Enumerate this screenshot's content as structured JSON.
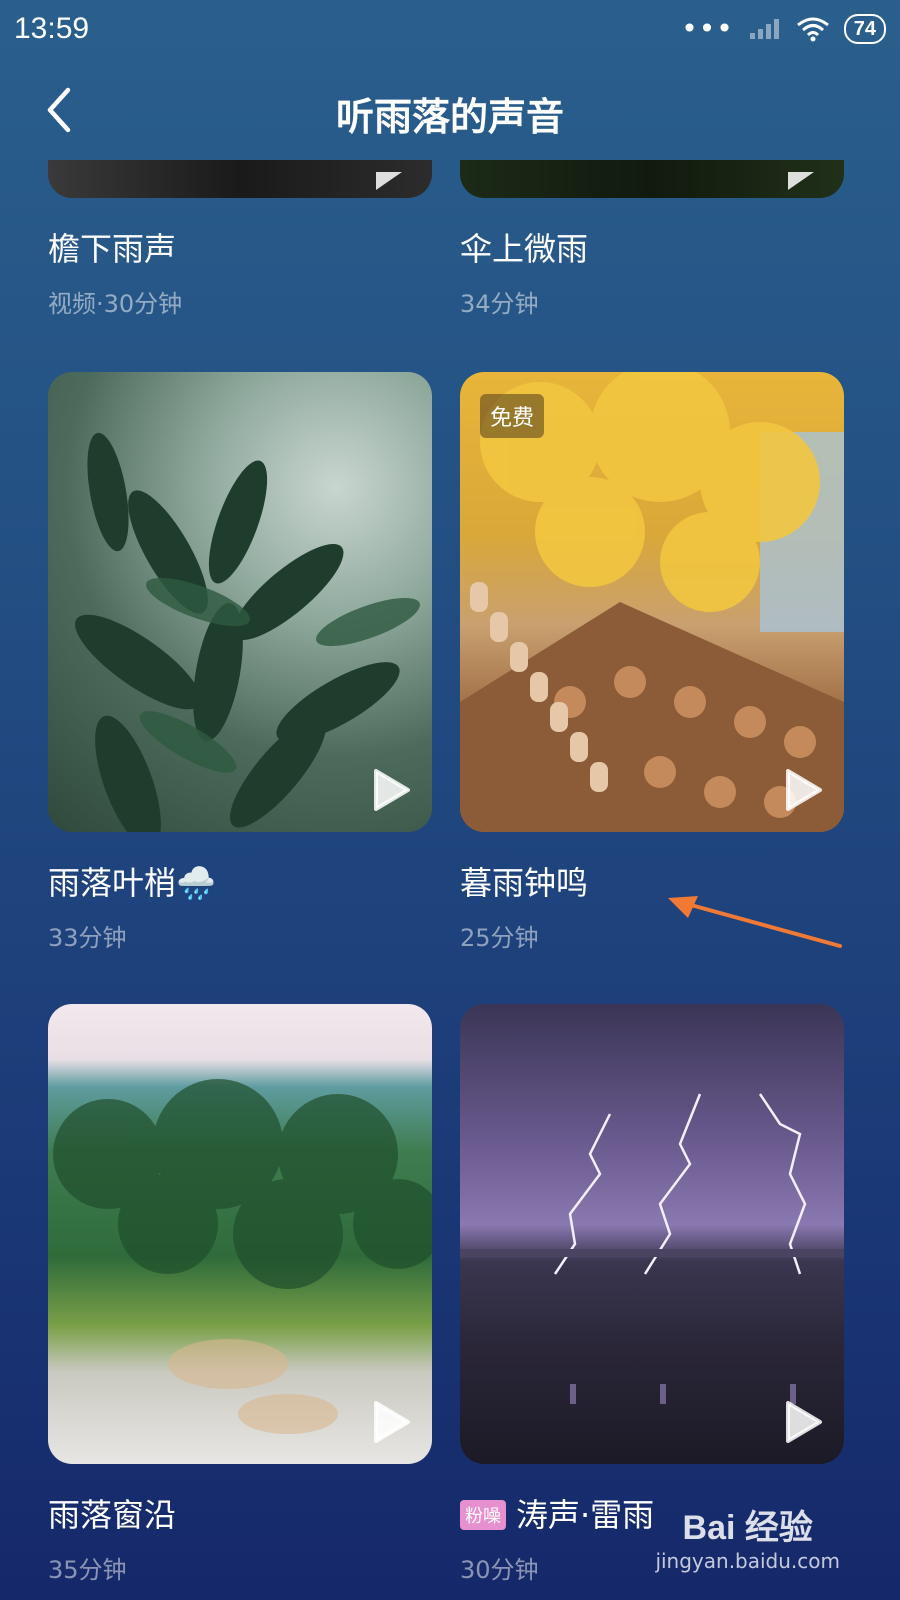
{
  "status_bar": {
    "time": "13:59",
    "battery": "74",
    "icons": [
      "dots-icon",
      "signal-icon",
      "wifi-icon",
      "battery-icon"
    ]
  },
  "header": {
    "title": "听雨落的声音",
    "back_icon": "back-arrow-icon"
  },
  "cards": [
    {
      "title": "檐下雨声",
      "subtitle": "视频·30分钟"
    },
    {
      "title": "伞上微雨",
      "subtitle": "34分钟"
    },
    {
      "title": "雨落叶梢",
      "emoji": "🌧️",
      "subtitle": "33分钟"
    },
    {
      "title": "暮雨钟鸣",
      "subtitle": "25分钟",
      "badge": "免费"
    },
    {
      "title": "雨落窗沿",
      "subtitle": "35分钟"
    },
    {
      "title": "涛声·雷雨",
      "subtitle": "30分钟",
      "tag": "粉噪"
    }
  ],
  "watermark": {
    "logo": "Bai 经验",
    "url": "jingyan.baidu.com"
  }
}
